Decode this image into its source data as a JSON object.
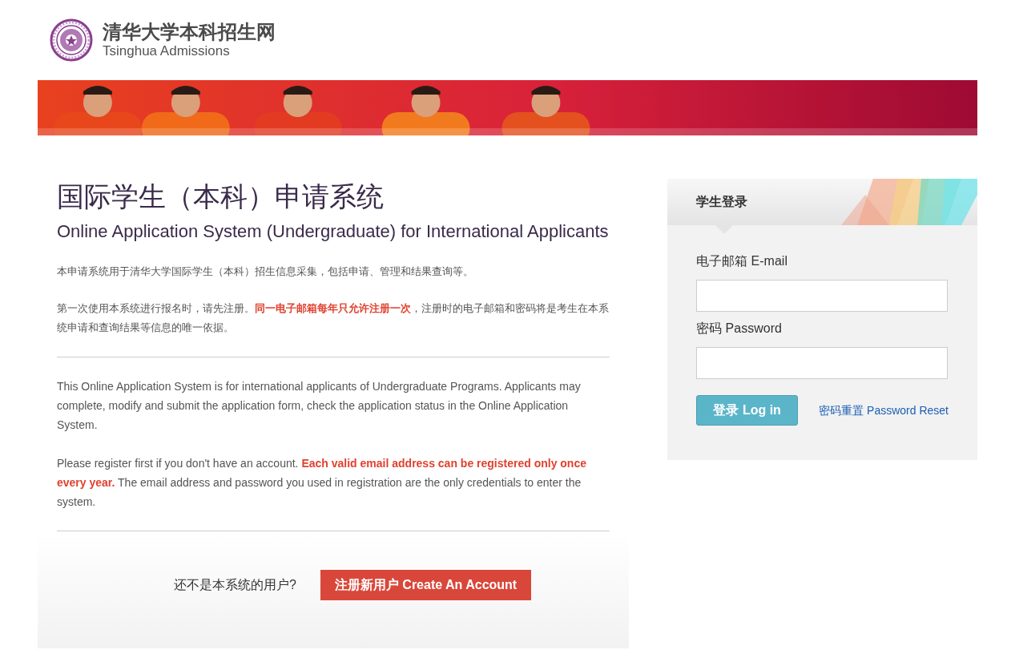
{
  "header": {
    "title_zh": "清华大学本科招生网",
    "title_en": "Tsinghua Admissions"
  },
  "main": {
    "title_zh": "国际学生（本科）申请系统",
    "title_en": "Online Application System (Undergraduate) for International Applicants",
    "paragraphs_zh": [
      "本申请系统用于清华大学国际学生（本科）招生信息采集，包括申请、管理和结果查询等。",
      "第一次使用本系统进行报名时，请先注册。**同一电子邮箱每年只允许注册一次**，注册时的电子邮箱和密码将是考生在本系统申请和查询结果等信息的唯一依据。"
    ],
    "paragraphs_en": [
      "This Online Application System is for international applicants of Undergraduate Programs. Applicants may complete, modify and submit the application form, check the application status in the Online Application System.",
      "Please register first if you don't have an account. **Each valid email address can be registered only once every year.** The email address and password you used in registration are the only credentials to enter the system."
    ],
    "register_prompt": "还不是本系统的用户?",
    "register_button": "注册新用户 Create An Account"
  },
  "login": {
    "title": "学生登录",
    "email_label": "电子邮箱 E-mail",
    "password_label": "密码 Password",
    "login_button": "登录 Log in",
    "reset_link": "密码重置 Password Reset"
  }
}
